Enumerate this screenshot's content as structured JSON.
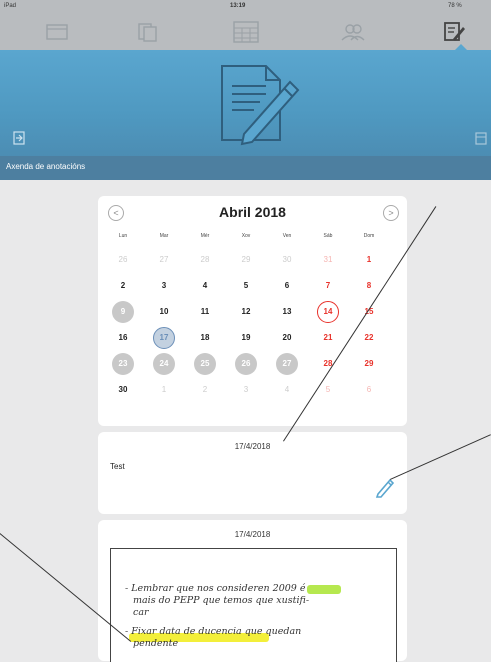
{
  "status": {
    "device": "iPad",
    "time": "13:19",
    "battery": "78 %"
  },
  "header": {
    "section_title": "Axenda de anotacións"
  },
  "calendar": {
    "month_title": "Abril 2018",
    "prev": "<",
    "next": ">",
    "weekdays": [
      "Lun",
      "Mar",
      "Mér",
      "Xov",
      "Ven",
      "Sáb",
      "Dom"
    ],
    "weeks": [
      [
        "26",
        "27",
        "28",
        "29",
        "30",
        "31",
        "1"
      ],
      [
        "2",
        "3",
        "4",
        "5",
        "6",
        "7",
        "8"
      ],
      [
        "9",
        "10",
        "11",
        "12",
        "13",
        "14",
        "15"
      ],
      [
        "16",
        "17",
        "18",
        "19",
        "20",
        "21",
        "22"
      ],
      [
        "23",
        "24",
        "25",
        "26",
        "27",
        "28",
        "29"
      ],
      [
        "30",
        "1",
        "2",
        "3",
        "4",
        "5",
        "6"
      ]
    ]
  },
  "note_card": {
    "date": "17/4/2018",
    "text": "Test"
  },
  "handwritten_card": {
    "date": "17/4/2018",
    "lines": [
      "- Lembrar que nos consideren 2009 é",
      "mais do PEPP que temos que xustifi-",
      "car",
      "- Fixar data de ducencia que quedan",
      "pendente"
    ]
  },
  "colors": {
    "accent_blue": "#5aa6cf",
    "weekend_red": "#e8312a",
    "highlight_yellow": "#f3ef3a",
    "highlight_green": "#b6e84f"
  }
}
